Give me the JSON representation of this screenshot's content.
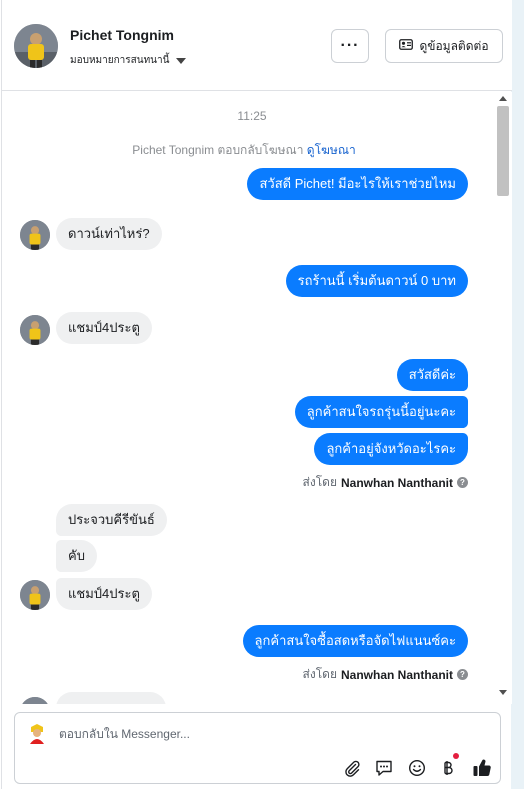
{
  "header": {
    "contact_name": "Pichet Tongnim",
    "assign_label": "มอบหมายการสนทนานี้",
    "more_label": "···",
    "contact_info_label": "ดูข้อมูลติดต่อ"
  },
  "chat": {
    "timestamp": "11:25",
    "ad_reply_text": "Pichet Tongnim ตอบกลับโฆษณา",
    "ad_reply_link": "ดูโฆษณา",
    "messages": [
      {
        "dir": "out",
        "text": "สวัสดี Pichet! มีอะไรให้เราช่วยไหม"
      },
      {
        "dir": "in",
        "text": "ดาวน์เท่าไหร่?"
      },
      {
        "dir": "out",
        "text": "รถร้านนี้ เริ่มต้นดาวน์ 0 บาท"
      },
      {
        "dir": "in",
        "text": "แชมป์4ประตู"
      },
      {
        "dir": "out",
        "text": "สวัสดีค่ะ"
      },
      {
        "dir": "out",
        "text": "ลูกค้าสนใจรถรุ่นนี้อยู่นะคะ"
      },
      {
        "dir": "out",
        "text": "ลูกค้าอยู่จังหวัดอะไรคะ"
      },
      {
        "dir": "in",
        "text": "ประจวบคีรีขันธ์"
      },
      {
        "dir": "in",
        "text": "คับ"
      },
      {
        "dir": "in",
        "text": "แชมป์4ประตู"
      },
      {
        "dir": "out",
        "text": "ลูกค้าสนใจซื้อสดหรือจัดไฟแนนซ์คะ"
      }
    ],
    "sent_by_prefix": "ส่งโดย",
    "sent_by_name": "Nanwhan Nanthanit"
  },
  "composer": {
    "placeholder": "ตอบกลับใน Messenger..."
  },
  "colors": {
    "outgoing_bubble": "#0a7cff",
    "incoming_bubble": "#eff0f1",
    "link": "#1763cf",
    "like_icon": "#1c1e21",
    "notification_dot": "#e41e3f"
  },
  "icons": [
    "attach-icon",
    "saved-reply-icon",
    "emoji-icon",
    "baht-payment-icon",
    "like-icon",
    "info-icon"
  ]
}
